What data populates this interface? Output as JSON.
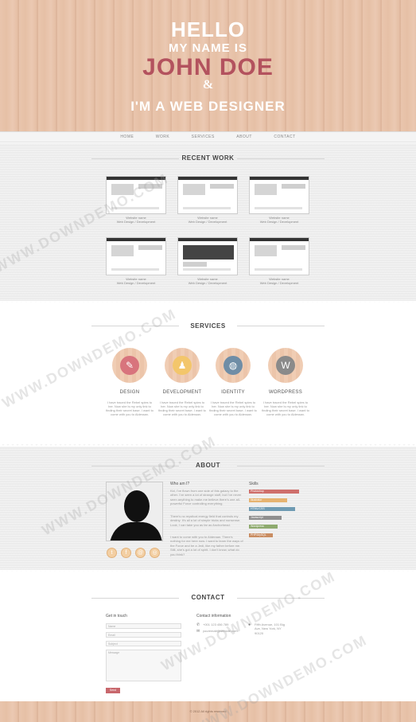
{
  "hero": {
    "line1": "HELLO",
    "line2": "MY NAME IS",
    "line3": "JOHN DOE",
    "line4": "&",
    "line5": "I'M A WEB DESIGNER"
  },
  "nav": [
    "HOME",
    "WORK",
    "SERVICES",
    "ABOUT",
    "CONTACT"
  ],
  "recent_work": {
    "title": "RECENT WORK",
    "items": [
      {
        "name": "Website name",
        "sub": "Web Design / Development"
      },
      {
        "name": "Website name",
        "sub": "Web Design / Development"
      },
      {
        "name": "Website name",
        "sub": "Web Design / Development"
      },
      {
        "name": "Website name",
        "sub": "Web Design / Development"
      },
      {
        "name": "Website name",
        "sub": "Web Design / Development"
      },
      {
        "name": "Website name",
        "sub": "Web Design / Development"
      }
    ]
  },
  "services": {
    "title": "SERVICES",
    "items": [
      {
        "name": "DESIGN",
        "icon": "brush-icon",
        "color": "#d8747d",
        "text": "I have traced the Rebel spies to her. Now she is my only link to finding their secret base. I want to come with you to Alderaan."
      },
      {
        "name": "DEVELOPMENT",
        "icon": "chess-pawn-icon",
        "color": "#f3c66b",
        "text": "I have traced the Rebel spies to her. Now she is my only link to finding their secret base. I want to come with you to Alderaan."
      },
      {
        "name": "IDENTITY",
        "icon": "globe-icon",
        "color": "#6f8da6",
        "text": "I have traced the Rebel spies to her. Now she is my only link to finding their secret base. I want to come with you to Alderaan."
      },
      {
        "name": "WORDPRESS",
        "icon": "wordpress-icon",
        "color": "#8a8a8a",
        "text": "I have traced the Rebel spies to her. Now she is my only link to finding their secret base. I want to come with you to Alderaan."
      }
    ]
  },
  "about": {
    "title": "ABOUT",
    "who_heading": "Who am I?",
    "paragraphs": [
      "Kid, I've flown from one side of this galaxy to the other. I've seen a lot of strange stuff, but I've never seen anything to make me believe there's one all-powerful Force controlling everything.",
      "There's no mystical energy field that controls my destiny. It's all a lot of simple tricks and nonsense. Look, I can take you as far as Anchorhead.",
      "I want to come with you to Alderaan. There's nothing for me here now. I want to learn the ways of the Force and be a Jedi, like my father before me. Still, she's got a lot of spirit. I don't know, what do you think?"
    ],
    "skills_heading": "Skills",
    "skills": [
      {
        "label": "Photoshop",
        "color": "#cf6f6c",
        "level": 0.95
      },
      {
        "label": "Illustrator",
        "color": "#e6b370",
        "level": 0.72
      },
      {
        "label": "HTML/CSS",
        "color": "#6f9bb3",
        "level": 0.88
      },
      {
        "label": "Javascript",
        "color": "#8f8f8f",
        "level": 0.62
      },
      {
        "label": "Wordpress",
        "color": "#8eaa6e",
        "level": 0.55
      },
      {
        "label": "PHP/MySQL",
        "color": "#c98d62",
        "level": 0.45
      }
    ],
    "social": [
      {
        "icon": "twitter-icon",
        "glyph": "t"
      },
      {
        "icon": "facebook-icon",
        "glyph": "f"
      },
      {
        "icon": "email-icon",
        "glyph": "@"
      },
      {
        "icon": "dribbble-icon",
        "glyph": "◎"
      }
    ]
  },
  "contact": {
    "title": "CONTACT",
    "get_in_touch": "Get in touch",
    "placeholders": {
      "name": "Name",
      "email": "Email",
      "subject": "Subject",
      "message": "Message"
    },
    "send_label": "Send",
    "info_heading": "Contact information",
    "phone": "+001 123 456 789",
    "email": "youremail@website.com",
    "address": "Fifth Avenue, 101 Big Ave, New York, NY 90120"
  },
  "footer": {
    "copyright": "© 2012 All rights reserved"
  },
  "watermark": "WWW.DOWNDEMO.COM"
}
